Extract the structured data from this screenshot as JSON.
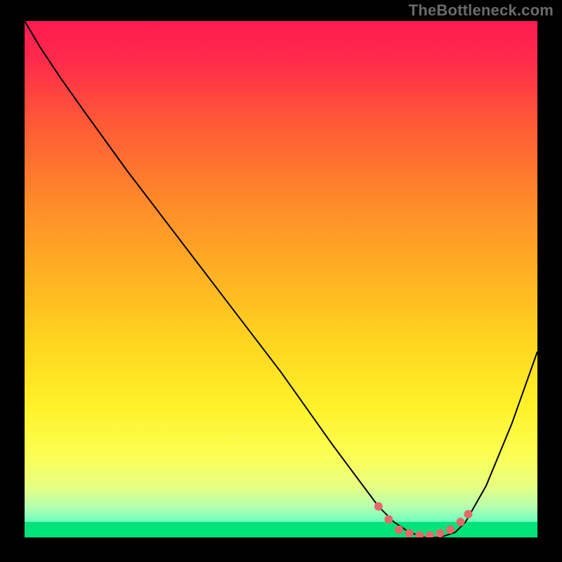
{
  "watermark": "TheBottleneck.com",
  "chart_data": {
    "type": "line",
    "title": "",
    "xlabel": "",
    "ylabel": "",
    "xlim": [
      0,
      100
    ],
    "ylim": [
      0,
      100
    ],
    "grid": false,
    "legend": false,
    "background_gradient": {
      "stops": [
        {
          "offset": 0.0,
          "color": "#ff1a52"
        },
        {
          "offset": 0.08,
          "color": "#ff2c4a"
        },
        {
          "offset": 0.2,
          "color": "#ff5a36"
        },
        {
          "offset": 0.35,
          "color": "#ff8a2a"
        },
        {
          "offset": 0.5,
          "color": "#ffb422"
        },
        {
          "offset": 0.63,
          "color": "#ffd720"
        },
        {
          "offset": 0.75,
          "color": "#fff22a"
        },
        {
          "offset": 0.84,
          "color": "#fbff54"
        },
        {
          "offset": 0.9,
          "color": "#e8ff80"
        },
        {
          "offset": 0.94,
          "color": "#b8ffb0"
        },
        {
          "offset": 0.975,
          "color": "#5fffc0"
        },
        {
          "offset": 1.0,
          "color": "#00e27a"
        }
      ]
    },
    "bottom_green_band": {
      "y_from": 97,
      "y_to": 100
    },
    "series": [
      {
        "name": "curve",
        "color": "#000000",
        "stroke_width": 2,
        "x": [
          0,
          3,
          7,
          12,
          20,
          30,
          40,
          50,
          60,
          66,
          69,
          72,
          75,
          78,
          81,
          84,
          86,
          90,
          95,
          100
        ],
        "y": [
          0,
          5,
          11,
          18,
          29,
          42,
          55,
          68,
          82,
          90,
          94,
          97,
          99,
          100,
          100,
          99,
          97,
          90,
          78,
          64
        ]
      },
      {
        "name": "optimal-region-dots",
        "type": "scatter",
        "color": "#e46a6a",
        "marker_radius": 6,
        "x": [
          69,
          71,
          73,
          75,
          77,
          79,
          81,
          83,
          85,
          86.5
        ],
        "y": [
          94,
          96.5,
          98.5,
          99.2,
          99.6,
          99.6,
          99.2,
          98.5,
          97,
          95.5
        ]
      }
    ],
    "annotations": []
  }
}
